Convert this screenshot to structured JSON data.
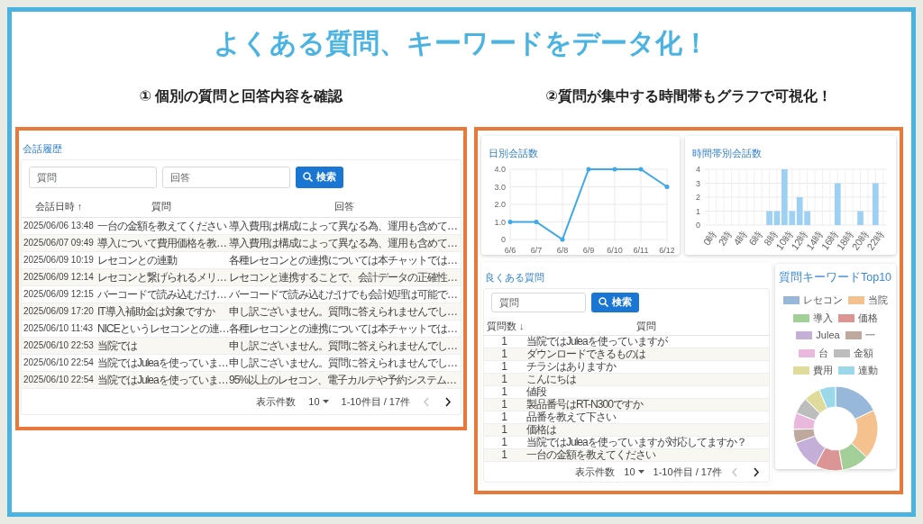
{
  "title": "よくある質問、キーワードをデータ化！",
  "left_heading": "① 個別の質問と回答内容を確認",
  "right_heading": "②質問が集中する時間帯もグラフで可視化！",
  "history": {
    "title": "会話履歴",
    "fields": [
      {
        "placeholder": "質問"
      },
      {
        "placeholder": "回答"
      }
    ],
    "search_button": "検索",
    "columns": [
      {
        "label": "会話日時",
        "sort_icon": "↑"
      },
      {
        "label": "質問"
      },
      {
        "label": "回答"
      }
    ],
    "rows": [
      [
        "2025/06/06 13:48",
        "一台の金額を教えてください",
        "導入費用は構成によって異なる為、運用も含めて…"
      ],
      [
        "2025/06/07 09:49",
        "導入について費用価格を教…",
        "導入費用は構成によって異なる為、運用も含めて…"
      ],
      [
        "2025/06/09 10:19",
        "レセコンとの連動",
        "各種レセコンとの連携については本チャットでは…"
      ],
      [
        "2025/06/09 12:14",
        "レセコンと繋げられるメリ…",
        "レセコンと連携することで、会計データの正確性…"
      ],
      [
        "2025/06/09 12:15",
        "バーコードで読み込むだけ…",
        "バーコードで読み込むだけでも会計処理は可能で…"
      ],
      [
        "2025/06/09 17:20",
        "IT導入補助金は対象ですか",
        "申し訳ございません。質問に答えられませんでし…"
      ],
      [
        "2025/06/10 11:43",
        "NICEというレセコンとの連…",
        "各種レセコンとの連携については本チャットでは…"
      ],
      [
        "2025/06/10 22:53",
        "当院では",
        "申し訳ございません。質問に答えられませんでし…"
      ],
      [
        "2025/06/10 22:54",
        "当院ではJuleaを使っていま…",
        "申し訳ございません。質問に答えられませんでし…"
      ],
      [
        "2025/06/10 22:54",
        "当院ではJuleaを使っていま…",
        "95%以上のレセコン、電子カルテや予約システム…"
      ]
    ],
    "pagination": {
      "label": "表示件数",
      "page_size": "10",
      "range": "1-10件目 / 17件",
      "prev_disabled": true,
      "next_disabled": false
    }
  },
  "daily_chart": {
    "title": "日別会話数",
    "chart_data": {
      "type": "line",
      "categories": [
        "6/6",
        "6/7",
        "6/8",
        "6/9",
        "6/10",
        "6/11",
        "6/12"
      ],
      "series": [
        {
          "color": "#3ea8ea",
          "values": [
            1,
            1,
            0,
            4,
            4,
            4,
            3
          ]
        }
      ],
      "grid": true,
      "ylim": [
        0,
        4
      ],
      "yticks": [
        {
          "value": 0,
          "label": "0"
        },
        {
          "value": 1,
          "label": "1.0"
        },
        {
          "value": 2,
          "label": "2.0"
        },
        {
          "value": 3,
          "label": "3.0"
        },
        {
          "value": 4,
          "label": "4.0"
        }
      ]
    }
  },
  "hourly_chart": {
    "title": "時間帯別会話数",
    "chart_data": {
      "type": "bar",
      "x": [
        0,
        1,
        2,
        3,
        4,
        5,
        6,
        7,
        8,
        9,
        10,
        11,
        12,
        13,
        14,
        15,
        16,
        17,
        18,
        19,
        20,
        21,
        22,
        23
      ],
      "series": [
        {
          "color": "#9ed0f3",
          "values": [
            0,
            0,
            0,
            0,
            0,
            0,
            0,
            0,
            1,
            1,
            4,
            1,
            2,
            1,
            0,
            0,
            0,
            3,
            0,
            0,
            1,
            0,
            3,
            0
          ]
        }
      ],
      "grid": true,
      "xlim": [
        -0.5,
        23.5
      ],
      "ylim": [
        0,
        4
      ],
      "yticks": [
        0,
        1,
        2,
        3,
        4
      ],
      "xticks": [
        {
          "value": 0,
          "label": "0時"
        },
        {
          "value": 2,
          "label": "2時"
        },
        {
          "value": 4,
          "label": "4時"
        },
        {
          "value": 6,
          "label": "6時"
        },
        {
          "value": 8,
          "label": "8時"
        },
        {
          "value": 10,
          "label": "10時"
        },
        {
          "value": 12,
          "label": "12時"
        },
        {
          "value": 14,
          "label": "14時"
        },
        {
          "value": 16,
          "label": "16時"
        },
        {
          "value": 18,
          "label": "18時"
        },
        {
          "value": 20,
          "label": "20時"
        },
        {
          "value": 22,
          "label": "22時"
        }
      ]
    }
  },
  "faq": {
    "title": "良くある質問",
    "field": {
      "placeholder": "質問"
    },
    "search_button": "検索",
    "columns": [
      {
        "label": "質問数",
        "sort_icon": "↓"
      },
      {
        "label": "質問"
      }
    ],
    "rows": [
      [
        "1",
        "当院ではJuleaを使っていますが"
      ],
      [
        "1",
        "ダウンロードできるものは"
      ],
      [
        "1",
        "チラシはありますか"
      ],
      [
        "1",
        "こんにちは"
      ],
      [
        "1",
        "値段"
      ],
      [
        "1",
        "製品番号はRT-N300ですか"
      ],
      [
        "1",
        "品番を教えて下さい"
      ],
      [
        "1",
        "価格は"
      ],
      [
        "1",
        "当院ではJuleaを使っていますが対応してますか？"
      ],
      [
        "1",
        "一台の金額を教えてください"
      ]
    ],
    "pagination": {
      "label": "表示件数",
      "page_size": "10",
      "range": "1-10件目 / 17件",
      "prev_disabled": true,
      "next_disabled": false
    }
  },
  "keywords": {
    "title": "質問キーワードTop10",
    "legend": [
      {
        "label": "レセコン",
        "color": "#97b8d8"
      },
      {
        "label": "当院",
        "color": "#f5c18f"
      },
      {
        "label": "導入",
        "color": "#a3cf98"
      },
      {
        "label": "価格",
        "color": "#dc9595"
      },
      {
        "label": "Julea",
        "color": "#c4afd8"
      },
      {
        "label": "一",
        "color": "#bfa89e"
      },
      {
        "label": "台",
        "color": "#eab8dc"
      },
      {
        "label": "金額",
        "color": "#bdbdbd"
      },
      {
        "label": "費用",
        "color": "#dfdb9b"
      },
      {
        "label": "連動",
        "color": "#9ad8ea"
      }
    ]
  }
}
